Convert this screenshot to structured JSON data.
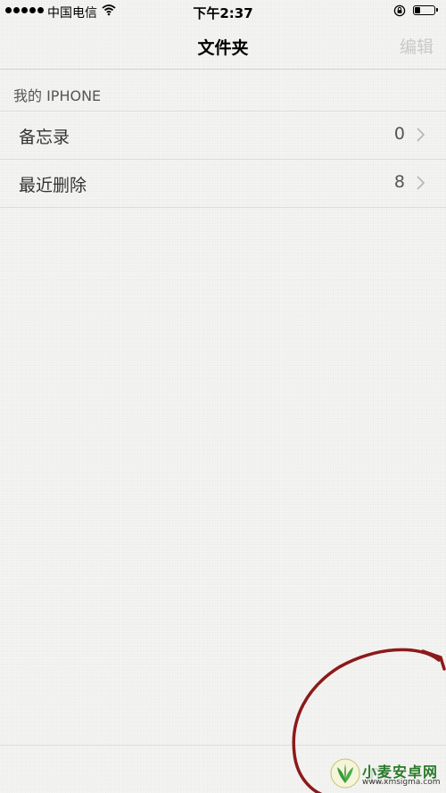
{
  "status_bar": {
    "carrier": "中国电信",
    "time": "下午2:37",
    "battery_level": 0.3
  },
  "nav": {
    "title": "文件夹",
    "edit_label": "编辑"
  },
  "section": {
    "header": "我的 IPHONE"
  },
  "folders": [
    {
      "label": "备忘录",
      "count": "0"
    },
    {
      "label": "最近删除",
      "count": "8"
    }
  ],
  "colors": {
    "background": "#f4f4f2",
    "edit_disabled": "#c9c9c9",
    "annotation": "#8b1a1a"
  },
  "icons": [
    "signal-dots-icon",
    "wifi-icon",
    "rotation-lock-icon",
    "battery-icon",
    "chevron-right-icon",
    "compose-icon"
  ],
  "watermark": {
    "name": "小麦安卓网",
    "url": "www.xmsigma.com"
  }
}
